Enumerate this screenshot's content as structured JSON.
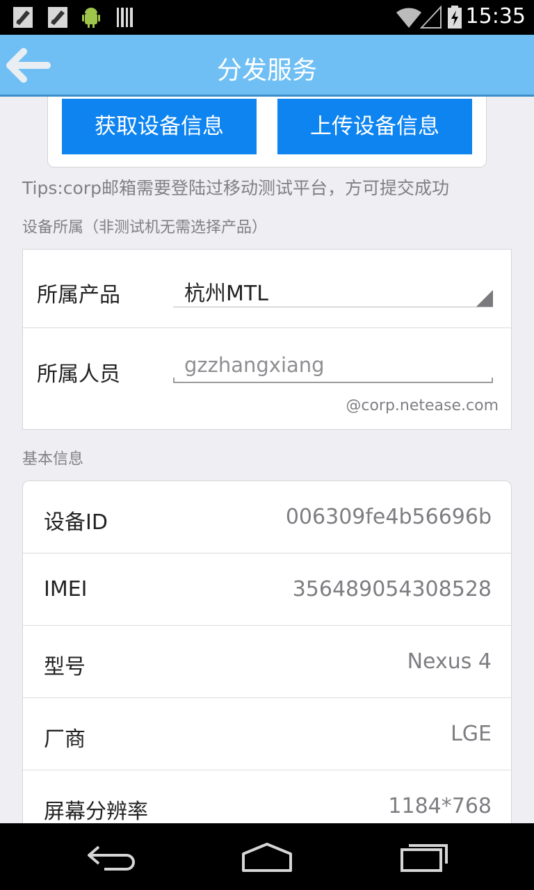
{
  "status_bar": {
    "time": "15:35",
    "icons": [
      "notification-app-icon",
      "notification-app-icon",
      "android-debug-icon",
      "barcode-icon",
      "wifi-icon",
      "cell-signal-icon",
      "battery-charging-icon"
    ]
  },
  "header": {
    "title": "分发服务",
    "back_icon": "back-arrow-icon"
  },
  "actions": {
    "get_info": "获取设备信息",
    "upload_info": "上传设备信息"
  },
  "tips": "Tips:corp邮箱需要登陆过移动测试平台，方可提交成功",
  "ownership": {
    "section_label": "设备所属（非测试机无需选择产品）",
    "product_label": "所属产品",
    "product_value": "杭州MTL",
    "member_label": "所属人员",
    "member_placeholder": "gzzhangxiang",
    "domain_hint": "@corp.netease.com"
  },
  "basic_info": {
    "section_label": "基本信息",
    "rows": [
      {
        "label": "设备ID",
        "value": "006309fe4b56696b"
      },
      {
        "label": "IMEI",
        "value": "356489054308528"
      },
      {
        "label": "型号",
        "value": "Nexus 4"
      },
      {
        "label": "厂商",
        "value": "LGE"
      },
      {
        "label": "屏幕分辨率",
        "value": "1184*768"
      }
    ]
  },
  "nav_bar": {
    "icons": [
      "nav-back-icon",
      "nav-home-icon",
      "nav-recents-icon"
    ]
  },
  "colors": {
    "header_bg": "#70bff4",
    "button_blue": "#0e84f0",
    "page_bg": "#eeeef3"
  }
}
